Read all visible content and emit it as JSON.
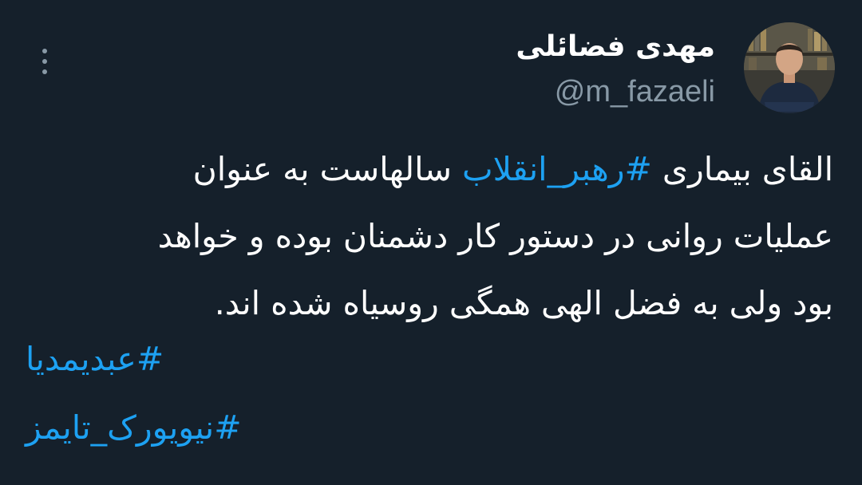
{
  "author": {
    "display_name": "مهدی فضائلی",
    "handle": "@m_fazaeli",
    "avatar_icon": "user-photo-avatar"
  },
  "menu": {
    "icon": "more-vertical-icon"
  },
  "tweet": {
    "line1_prefix": "القای بیماری ",
    "line1_hashtag": "#رهبر_انقلاب",
    "line1_suffix": " سالهاست به عنوان",
    "line2": "عملیات روانی در دستور کار دشمنان بوده و خواهد",
    "line3": "بود ولی به فضل الهی همگی روسیاه شده اند.",
    "hashtag2": "#عبدیمدیا",
    "hashtag3": "#نیویورک_تایمز"
  },
  "colors": {
    "background": "#15202b",
    "text": "#ffffff",
    "secondary": "#8899a6",
    "link": "#1da1f2"
  }
}
